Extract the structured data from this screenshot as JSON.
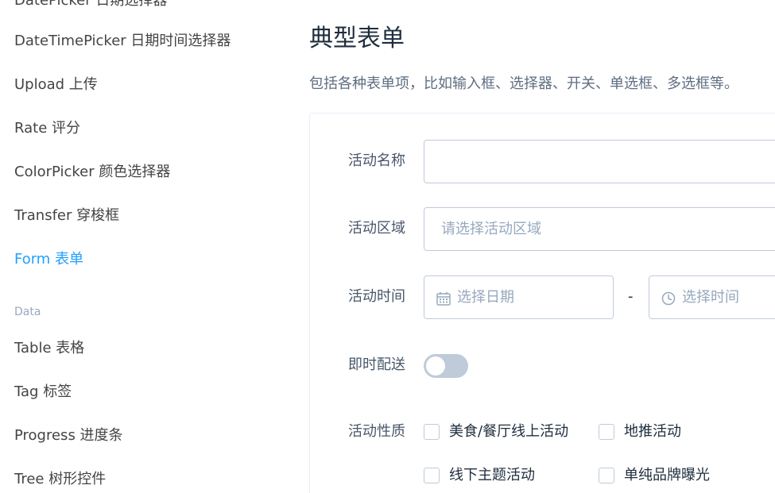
{
  "sidebar": {
    "items": [
      {
        "label": "DatePicker 日期选择器",
        "active": false
      },
      {
        "label": "DateTimePicker 日期时间选择器",
        "active": false
      },
      {
        "label": "Upload 上传",
        "active": false
      },
      {
        "label": "Rate 评分",
        "active": false
      },
      {
        "label": "ColorPicker 颜色选择器",
        "active": false
      },
      {
        "label": "Transfer 穿梭框",
        "active": false
      },
      {
        "label": "Form 表单",
        "active": true
      }
    ],
    "group_data": "Data",
    "data_items": [
      {
        "label": "Table 表格"
      },
      {
        "label": "Tag 标签"
      },
      {
        "label": "Progress 进度条"
      },
      {
        "label": "Tree 树形控件"
      }
    ]
  },
  "main": {
    "title": "典型表单",
    "description": "包括各种表单项，比如输入框、选择器、开关、单选框、多选框等。",
    "form": {
      "name_label": "活动名称",
      "name_value": "",
      "region_label": "活动区域",
      "region_placeholder": "请选择活动区域",
      "time_label": "活动时间",
      "date_placeholder": "选择日期",
      "time_separator": "-",
      "time_placeholder": "选择时间",
      "delivery_label": "即时配送",
      "delivery_on": false,
      "type_label": "活动性质",
      "type_options": [
        {
          "label": "美食/餐厅线上活动",
          "checked": false
        },
        {
          "label": "地推活动",
          "checked": false
        },
        {
          "label": "线下主题活动",
          "checked": false
        },
        {
          "label": "单纯品牌曝光",
          "checked": false
        }
      ]
    }
  },
  "colors": {
    "accent": "#20a0ff",
    "border": "#bfcbd9",
    "placeholder": "#97a8be"
  },
  "icons": {
    "date_icon": "calendar-icon",
    "time_icon": "clock-icon"
  }
}
